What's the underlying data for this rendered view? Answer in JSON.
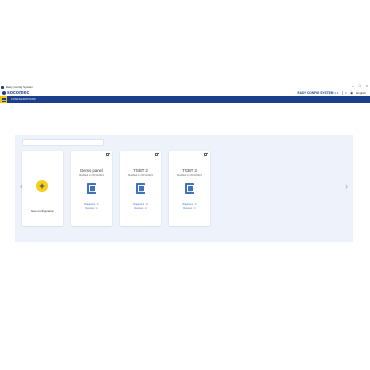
{
  "window": {
    "title": "Easy Config System",
    "controls": [
      "–",
      "□",
      "×"
    ]
  },
  "brand": {
    "logo": "socomec",
    "product": "EASY CONFIG SYSTEM",
    "version": "1.1",
    "language": "English"
  },
  "nav": {
    "menu_icon": "hamburger-icon",
    "label": "CONFIGURATIONS"
  },
  "search": {
    "placeholder": ""
  },
  "new_card": {
    "label": "New Configuration"
  },
  "cards": [
    {
      "name": "Demo panel",
      "date": "Modified on 05/11/2021",
      "stat1": "Diagrams : 0",
      "stat2": "Devices : 1"
    },
    {
      "name": "TGBT 2",
      "date": "Modified on 05/11/2021",
      "stat1": "Diagrams : 0",
      "stat2": "Devices : 2"
    },
    {
      "name": "TGBT 3",
      "date": "Modified on 05/11/2021",
      "stat1": "Diagrams : 0",
      "stat2": "Devices : 1"
    }
  ],
  "colors": {
    "primary": "#1b3f8c",
    "accent": "#f5d016",
    "panel": "#eef3fb"
  }
}
